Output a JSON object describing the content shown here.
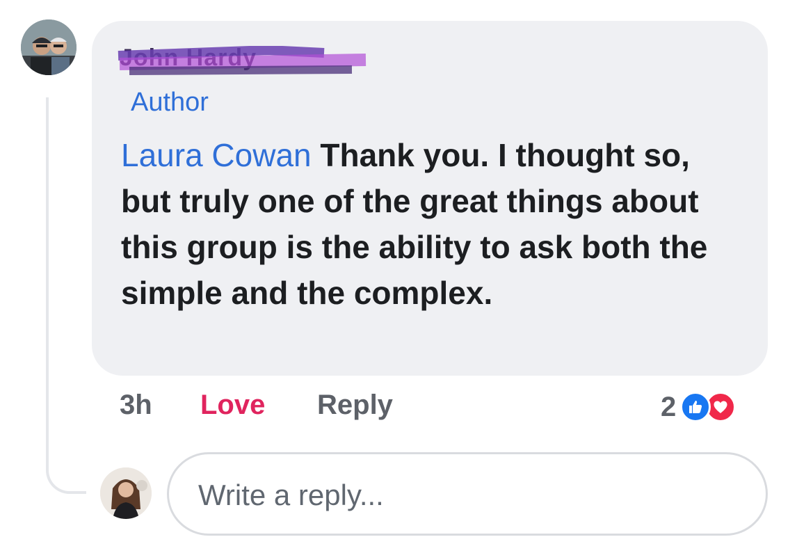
{
  "comment": {
    "author_name": "John Hardy",
    "author_badge": "Author",
    "mention": "Laura Cowan",
    "text": " Thank you. I thought so, but truly one of the great things about this group is the ability to ask both the simple and the complex."
  },
  "actions": {
    "time": "3h",
    "love_label": "Love",
    "reply_label": "Reply"
  },
  "reactions": {
    "count": "2",
    "types": [
      "like",
      "love"
    ],
    "colors": {
      "like": "#1877f2",
      "love": "#f0284a"
    }
  },
  "reply_box": {
    "placeholder": "Write a reply..."
  },
  "icons": {
    "avatar_main": "avatar-photo",
    "avatar_reply": "avatar-photo",
    "like": "thumbs-up-icon",
    "love": "heart-icon"
  }
}
